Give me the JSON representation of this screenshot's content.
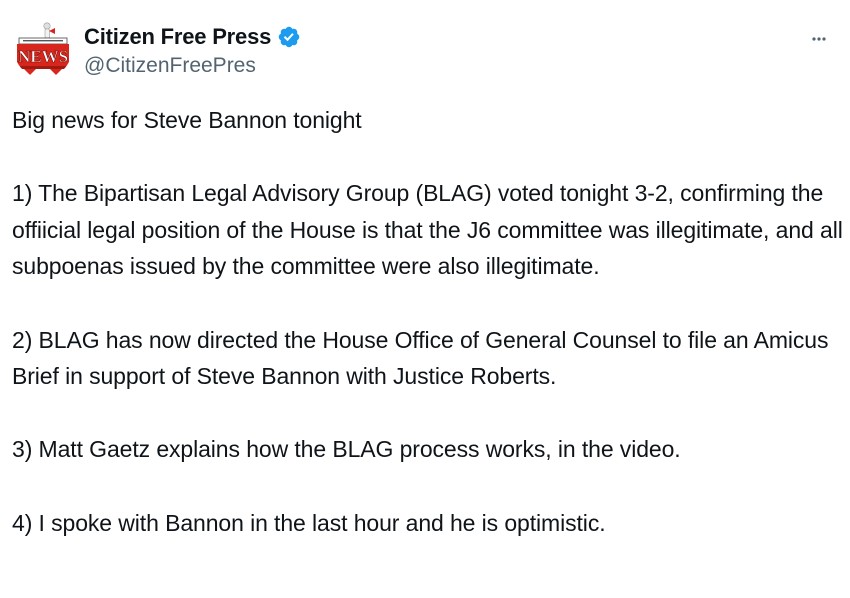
{
  "author": {
    "display_name": "Citizen Free Press",
    "handle": "@CitizenFreePres",
    "avatar_logo_text": "NEWS",
    "verified": true,
    "verified_color": "#1d9bf0"
  },
  "icons": {
    "more": "more-horizontal-icon",
    "verified": "verified-badge-icon"
  },
  "tweet": {
    "paragraphs": [
      "Big news for Steve Bannon tonight",
      "1) The Bipartisan Legal Advisory Group (BLAG) voted tonight 3-2, confirming the offiicial legal position of the House is that the J6 committee was illegitimate, and all subpoenas issued by the committee were also illegitimate.",
      "2) BLAG has now directed the House Office of General Counsel to file an Amicus Brief in support of Steve Bannon with Justice Roberts.",
      "3) Matt Gaetz explains how the BLAG process works, in the video.",
      "4) I spoke with Bannon in the last hour and he is optimistic."
    ]
  },
  "colors": {
    "text_primary": "#0f1419",
    "text_secondary": "#536471",
    "logo_red": "#d9261c"
  }
}
